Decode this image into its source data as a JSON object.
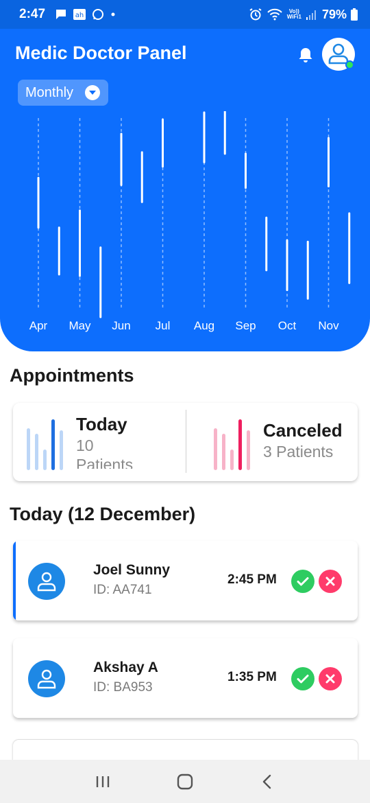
{
  "status_bar": {
    "time": "2:47",
    "battery": "79%",
    "volte_line1": "Vo))",
    "volte_line2": "WiFi1"
  },
  "header": {
    "title": "Medic Doctor Panel",
    "period": "Monthly"
  },
  "chart_data": {
    "type": "range-bar",
    "categories": [
      "Apr",
      "May",
      "Jun",
      "Jul",
      "Aug",
      "Sep",
      "Oct",
      "Nov"
    ],
    "series": [
      {
        "values": [
          [
            0.63,
            0.98
          ],
          [
            0.3,
            0.63
          ]
        ]
      },
      {
        "values": [
          [
            0.29,
            0.75
          ],
          [
            0.0,
            0.49
          ]
        ]
      },
      {
        "values": [
          [
            0.93,
            1.29
          ],
          [
            0.81,
            1.16
          ]
        ]
      },
      {
        "values": [
          [
            1.06,
            1.39
          ],
          [
            0.67,
            0.67
          ]
        ]
      },
      {
        "values": [
          [
            1.09,
            1.44
          ],
          [
            1.15,
            1.48
          ]
        ]
      },
      {
        "values": [
          [
            0.91,
            1.15
          ],
          [
            0.33,
            0.7
          ]
        ]
      },
      {
        "values": [
          [
            0.19,
            0.54
          ],
          [
            0.13,
            0.53
          ]
        ]
      },
      {
        "values": [
          [
            0.92,
            1.26
          ],
          [
            0.24,
            0.73
          ]
        ]
      }
    ],
    "note_values": "vertical ranges [low, high] in relative chart units, two sub-bars per month",
    "grid": true,
    "line_color": "#ffffff",
    "background": "#0d6efd"
  },
  "appointments": {
    "section_title": "Appointments",
    "today_label": "Today",
    "today_count": "10",
    "today_unit": "Patients",
    "canceled_label": "Canceled",
    "canceled_sub": "3 Patients",
    "today_bar_colors": [
      "#bcd6f7",
      "#bcd6f7",
      "#bcd6f7",
      "#1e6fe0",
      "#bcd6f7"
    ],
    "today_bar_values": [
      0.82,
      0.72,
      0.41,
      1.0,
      0.78
    ],
    "canceled_bar_colors": [
      "#f7b3c8",
      "#f7b3c8",
      "#f7b3c8",
      "#ef1f5f",
      "#f7b3c8"
    ],
    "canceled_bar_values": [
      0.82,
      0.72,
      0.41,
      1.0,
      0.78
    ]
  },
  "today_list": {
    "title": "Today (12 December)",
    "items": [
      {
        "name": "Joel Sunny",
        "id": "ID: AA741",
        "time": "2:45 PM"
      },
      {
        "name": "Akshay A",
        "id": "ID: BA953",
        "time": "1:35 PM"
      }
    ]
  },
  "colors": {
    "brand": "#0d6efd",
    "accept": "#2ecc61",
    "reject": "#ff3b6b"
  }
}
